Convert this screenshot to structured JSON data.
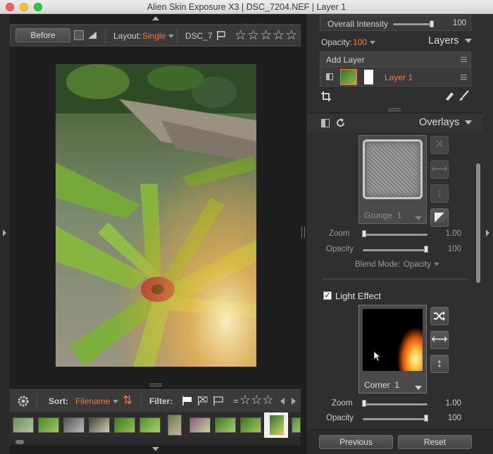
{
  "window": {
    "title": "Alien Skin Exposure X3 | DSC_7204.NEF | Layer 1"
  },
  "toolbar": {
    "before_label": "Before",
    "layout_label": "Layout:",
    "layout_value": "Single",
    "filename_short": "DSC_7",
    "rating_stars": "☆☆☆☆☆"
  },
  "filmbar": {
    "sort_label": "Sort:",
    "sort_value": "Filename",
    "filter_label": "Filter:",
    "equals": "=",
    "stars": "☆☆☆"
  },
  "layers_panel": {
    "overall_intensity_label": "Overall Intensity",
    "overall_intensity_value": "100",
    "overall_intensity_level": 100,
    "opacity_label": "Opacity:",
    "opacity_value": "100",
    "layers_title": "Layers",
    "add_layer_label": "Add Layer",
    "layer_name": "Layer 1"
  },
  "overlays_panel": {
    "title": "Overlays",
    "grunge": {
      "name": "Grunge",
      "number": "1",
      "zoom_label": "Zoom",
      "zoom_value": "1.00",
      "zoom_level": 0.0,
      "opacity_label": "Opacity",
      "opacity_value": "100",
      "opacity_level": 100,
      "blend_label": "Blend Mode:",
      "blend_value": "Opacity"
    },
    "light_effect": {
      "checkbox_label": "Light Effect",
      "checkbox_mark": "✓",
      "name": "Corner",
      "number": "1",
      "zoom_label": "Zoom",
      "zoom_value": "1.00",
      "zoom_level": 0.0,
      "opacity_label": "Opacity",
      "opacity_value": "100",
      "opacity_level": 100
    }
  },
  "footer": {
    "previous_label": "Previous",
    "reset_label": "Reset"
  },
  "icons": {
    "shuffle": "⤨",
    "flip_h": "⟷",
    "flip_v": "↕",
    "close": "✕",
    "sort_toggle": "⇅",
    "gear": "⚙"
  },
  "colors": {
    "accent": "#ee7a3e",
    "panel": "#3a3a3a",
    "background": "#1f1f1f"
  }
}
